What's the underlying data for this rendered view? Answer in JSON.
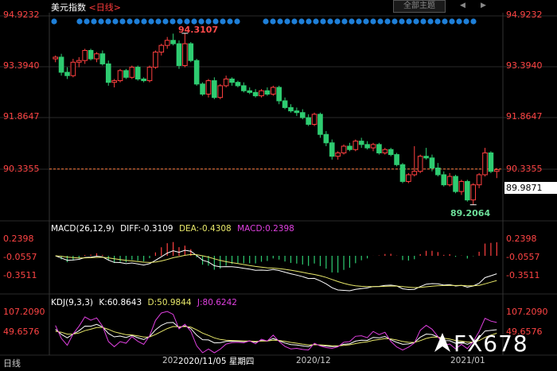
{
  "header": {
    "instrument": "美元指数",
    "timeframe": "<日线>",
    "theme_button": "全部主题",
    "prev_icon": "chevron-left-icon",
    "next_icon": "chevron-right-icon"
  },
  "price_axis": {
    "labels": [
      "94.9232",
      "93.3940",
      "91.8647",
      "90.3355"
    ],
    "current_price": "89.9871",
    "high_label": "94.3107",
    "low_label": "89.2064"
  },
  "macd": {
    "title": "MACD(26,12,9)",
    "diff": "DIFF:-0.3109",
    "dea": "DEA:-0.4308",
    "macd": "MACD:0.2398",
    "axis_labels": [
      "0.2398",
      "-0.0557",
      "-0.3511"
    ]
  },
  "kdj": {
    "title": "KDJ(9,3,3)",
    "k": "K:60.8643",
    "d": "D:50.9844",
    "j": "J:80.6242",
    "axis_labels": [
      "107.2090",
      "49.6576"
    ]
  },
  "x_axis": {
    "labels": [
      "202",
      "2020/12",
      "2021/01"
    ],
    "cursor_date": "2020/11/05 星期四",
    "period": "日线"
  },
  "watermark": "FX678",
  "colors": {
    "up": "#ff4040",
    "down": "#2ecc71",
    "diff_line": "#ffffff",
    "dea_line": "#e8e86a",
    "macd_line": "#e040e0",
    "event_dot": "#1e7fd8"
  },
  "chart_data": {
    "type": "candlestick",
    "title": "美元指数 <日线>",
    "price_range": [
      88.9,
      95.2
    ],
    "price_ticks": [
      94.9232,
      93.394,
      91.8647,
      90.3355
    ],
    "current_price": 89.9871,
    "period_high": 94.3107,
    "period_low": 89.2064,
    "candles": [
      [
        93.55,
        93.65,
        93.45,
        93.6
      ],
      [
        93.6,
        93.7,
        93.05,
        93.15
      ],
      [
        93.15,
        93.3,
        92.95,
        93.05
      ],
      [
        93.05,
        93.55,
        93.0,
        93.45
      ],
      [
        93.45,
        93.6,
        93.3,
        93.5
      ],
      [
        93.5,
        93.85,
        93.4,
        93.8
      ],
      [
        93.8,
        93.85,
        93.5,
        93.55
      ],
      [
        93.55,
        93.75,
        93.45,
        93.7
      ],
      [
        93.7,
        93.8,
        93.35,
        93.4
      ],
      [
        93.4,
        93.5,
        92.75,
        92.85
      ],
      [
        92.85,
        92.95,
        92.7,
        92.9
      ],
      [
        92.9,
        93.25,
        92.85,
        93.2
      ],
      [
        93.2,
        93.25,
        92.95,
        93.0
      ],
      [
        93.0,
        93.35,
        92.95,
        93.3
      ],
      [
        93.3,
        93.35,
        92.9,
        92.95
      ],
      [
        92.95,
        93.0,
        92.85,
        92.9
      ],
      [
        92.9,
        93.35,
        92.85,
        93.3
      ],
      [
        93.3,
        93.8,
        93.25,
        93.75
      ],
      [
        93.75,
        94.0,
        93.65,
        93.95
      ],
      [
        93.95,
        94.2,
        93.85,
        94.1
      ],
      [
        94.1,
        94.3,
        93.95,
        94.0
      ],
      [
        94.0,
        94.1,
        93.25,
        93.35
      ],
      [
        93.35,
        94.3107,
        93.3,
        94.0
      ],
      [
        94.0,
        94.05,
        93.45,
        93.5
      ],
      [
        93.5,
        93.55,
        92.75,
        92.8
      ],
      [
        92.8,
        92.85,
        92.45,
        92.5
      ],
      [
        92.5,
        92.95,
        92.4,
        92.9
      ],
      [
        92.9,
        93.0,
        92.35,
        92.4
      ],
      [
        92.4,
        92.8,
        92.35,
        92.75
      ],
      [
        92.75,
        93.05,
        92.7,
        92.95
      ],
      [
        92.95,
        93.0,
        92.75,
        92.85
      ],
      [
        92.85,
        92.9,
        92.7,
        92.75
      ],
      [
        92.75,
        92.85,
        92.55,
        92.6
      ],
      [
        92.6,
        92.7,
        92.5,
        92.55
      ],
      [
        92.55,
        92.65,
        92.4,
        92.45
      ],
      [
        92.45,
        92.65,
        92.4,
        92.6
      ],
      [
        92.6,
        92.7,
        92.45,
        92.5
      ],
      [
        92.5,
        92.75,
        92.45,
        92.7
      ],
      [
        92.7,
        92.75,
        92.2,
        92.3
      ],
      [
        92.3,
        92.4,
        92.05,
        92.1
      ],
      [
        92.1,
        92.2,
        91.95,
        92.0
      ],
      [
        92.0,
        92.1,
        91.85,
        91.95
      ],
      [
        91.95,
        92.05,
        91.75,
        91.8
      ],
      [
        91.8,
        91.9,
        91.55,
        91.6
      ],
      [
        91.6,
        91.95,
        91.55,
        91.9
      ],
      [
        91.9,
        91.95,
        91.2,
        91.3
      ],
      [
        91.3,
        91.4,
        90.95,
        91.05
      ],
      [
        91.05,
        91.15,
        90.55,
        90.65
      ],
      [
        90.65,
        90.8,
        90.55,
        90.75
      ],
      [
        90.75,
        91.0,
        90.7,
        90.95
      ],
      [
        90.95,
        91.05,
        90.8,
        90.85
      ],
      [
        90.85,
        91.15,
        90.8,
        91.1
      ],
      [
        91.1,
        91.2,
        90.9,
        91.0
      ],
      [
        91.0,
        91.1,
        90.85,
        90.9
      ],
      [
        90.9,
        91.05,
        90.8,
        91.0
      ],
      [
        91.0,
        91.05,
        90.7,
        90.75
      ],
      [
        90.75,
        90.9,
        90.7,
        90.85
      ],
      [
        90.85,
        90.9,
        90.65,
        90.7
      ],
      [
        90.7,
        90.75,
        90.35,
        90.4
      ],
      [
        90.4,
        90.45,
        89.85,
        89.9
      ],
      [
        89.9,
        90.15,
        89.85,
        90.1
      ],
      [
        90.1,
        90.95,
        90.05,
        90.2
      ],
      [
        90.2,
        90.7,
        90.15,
        90.65
      ],
      [
        90.65,
        90.9,
        90.55,
        90.6
      ],
      [
        90.6,
        90.7,
        90.2,
        90.3
      ],
      [
        90.3,
        90.45,
        90.05,
        90.1
      ],
      [
        90.1,
        90.2,
        89.75,
        89.8
      ],
      [
        89.8,
        90.15,
        89.75,
        90.05
      ],
      [
        90.05,
        90.1,
        89.55,
        89.6
      ],
      [
        89.6,
        89.95,
        89.5,
        89.9
      ],
      [
        89.9,
        89.95,
        89.3,
        89.35
      ],
      [
        89.35,
        89.85,
        89.2064,
        89.8
      ],
      [
        89.8,
        90.15,
        89.7,
        90.1
      ],
      [
        90.1,
        90.9,
        90.05,
        90.75
      ],
      [
        90.75,
        90.8,
        90.15,
        90.2
      ],
      [
        90.2,
        90.3,
        90.0,
        90.25
      ]
    ]
  }
}
